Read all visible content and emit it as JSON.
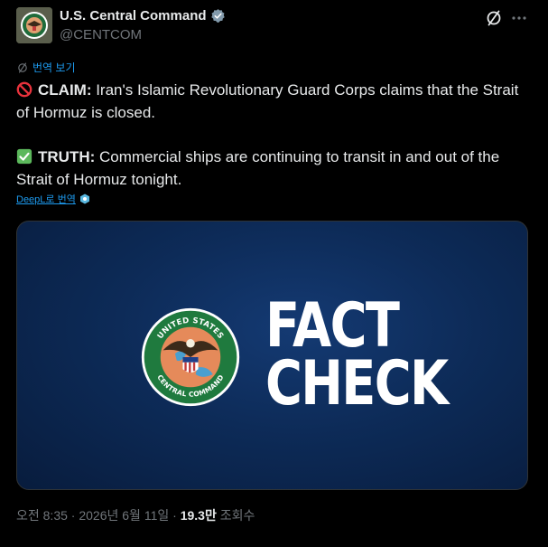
{
  "account": {
    "display_name": "U.S. Central Command",
    "handle": "@CENTCOM",
    "verified": true,
    "avatar_icon": "centcom-seal-icon"
  },
  "header_actions": {
    "grok_icon": "grok-icon",
    "more_icon": "more-dots-icon"
  },
  "translate": {
    "label": "번역 보기",
    "icon": "translate-icon"
  },
  "tweet": {
    "claim": {
      "emoji": "no-entry-emoji",
      "label": "CLAIM:",
      "text": " Iran's Islamic Revolutionary Guard Corps claims that the Strait of Hormuz is closed."
    },
    "truth": {
      "emoji": "check-mark-emoji",
      "label": "TRUTH:",
      "text": " Commercial ships are continuing to transit in and out of the Strait of Hormuz tonight."
    }
  },
  "deepl": {
    "label": "DeepL로 번역",
    "icon": "deepl-icon"
  },
  "media": {
    "headline_line1": "FACT",
    "headline_line2": "CHECK",
    "seal_top_text": "UNITED STATES",
    "seal_bottom_text": "CENTRAL COMMAND",
    "colors": {
      "background": "#0d2b58",
      "seal_ring": "#1f7a3e",
      "seal_inner": "#e58a5a"
    }
  },
  "meta": {
    "time": "오전 8:35",
    "separator": " · ",
    "date": "2026년 6월 11일",
    "views_count": "19.3만",
    "views_label": " 조회수"
  },
  "colors": {
    "accent": "#1d9bf0",
    "text": "#e7e9ea",
    "muted": "#71767b",
    "background": "#000000"
  }
}
